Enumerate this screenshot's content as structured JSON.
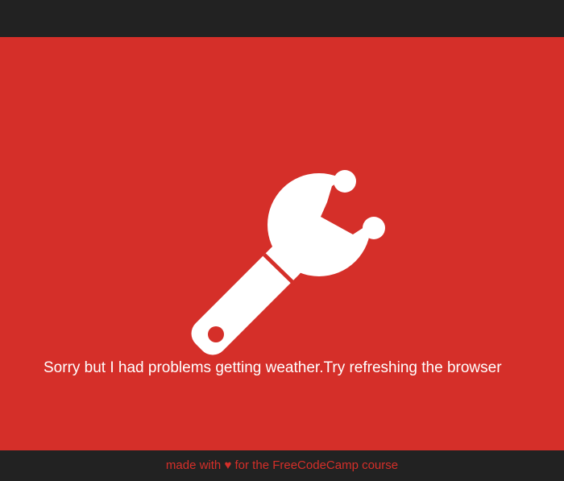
{
  "colors": {
    "background_dark": "#222222",
    "panel_red": "#d52f29",
    "text_white": "#ffffff",
    "footer_text": "#d52f29"
  },
  "main": {
    "icon": "wrench-icon",
    "message": "Sorry but I had problems getting weather.Try refreshing the browser"
  },
  "footer": {
    "text_before": "made with ",
    "heart": "♥",
    "text_after": " for the FreeCodeCamp course"
  }
}
